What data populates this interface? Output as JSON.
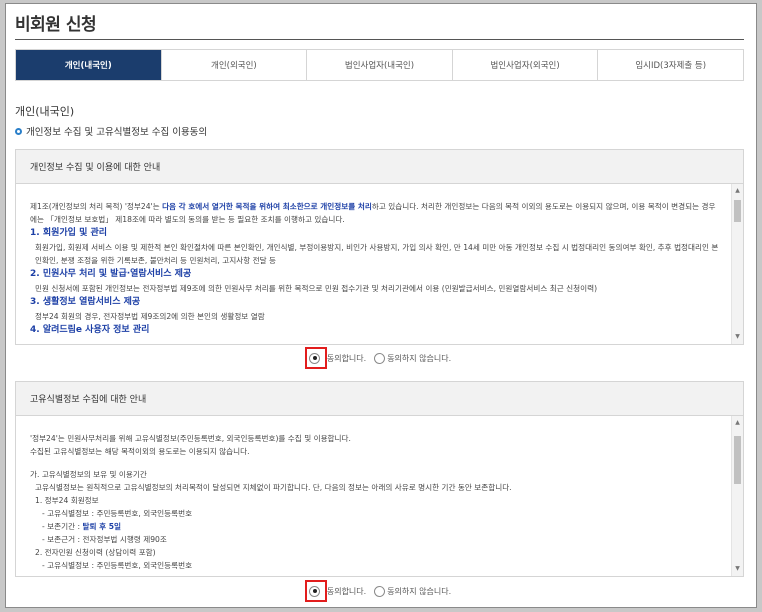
{
  "page": {
    "title": "비회원 신청"
  },
  "tabs": [
    {
      "label": "개인(내국인)",
      "active": true
    },
    {
      "label": "개인(외국인)",
      "active": false
    },
    {
      "label": "법인사업자(내국인)",
      "active": false
    },
    {
      "label": "법인사업자(외국인)",
      "active": false
    },
    {
      "label": "임시ID(3자제출 등)",
      "active": false
    }
  ],
  "section": {
    "heading": "개인(내국인)",
    "subheading": "개인정보 수집 및 고유식별정보 수집 이용동의"
  },
  "privacy_box": {
    "title": "개인정보 수집 및 이용에 대한 안내",
    "intro_a": "제1조(개인정보의 처리 목적) '정부24'는 ",
    "intro_strong": "다음 각 호에서 열거한 목적을 위하여 최소한으로 개인정보를 처리",
    "intro_b": "하고 있습니다. 처리한 개인정보는 다음의 목적 이외의 용도로는 이용되지 않으며, 이용 목적이 변경되는 경우에는 「개인정보 보호법」 제18조에 따라 별도의 동의를 받는 등 필요한 조치를 이행하고 있습니다.",
    "item1_title": "1. 회원가입 및 관리",
    "item1_text": "회원가입, 회원제 서비스 이용 및 제한적 본인 확인절차에 따른 본인확인, 개인식별, 부정이용방지, 비인가 사용방지, 가입 의사 확인, 만 14세 미만 아동 개인정보 수집 시 법정대리인 동의여부 확인, 추후 법정대리인 본인확인, 분쟁 조정을 위한 기록보존, 불만처리 등 민원처리, 고지사항 전달 등",
    "item2_title": "2. 민원사무 처리 및 발급·열람서비스 제공",
    "item2_text": "민원 신청서에 포함된 개인정보는 전자정부법 제9조에 의한 민원사무 처리를 위한 목적으로 민원 접수기관 및 처리기관에서 이용 (민원발급서비스, 민원열람서비스 최근 신청이력)",
    "item3_title": "3. 생활정보 열람서비스 제공",
    "item3_text": "정부24 회원의 경우, 전자정부법 제9조의2에 의한 본인의 생활정보 열람",
    "item4_title": "4. 알려드림e 사용자 정보 관리"
  },
  "unique_box": {
    "title": "고유식별정보 수집에 대한 안내",
    "line1": "'정부24'는 민원사무처리를 위해 고유식별정보(주민등록번호, 외국인등록번호)를 수집 및 이용합니다.",
    "line2": "수집된 고유식별정보는 해당 목적이외의 용도로는 이용되지 않습니다.",
    "line3": "가. 고유식별정보의 보유 및 이용기간",
    "line4": "고유식별정보는 원칙적으로 고유식별정보의 처리목적이 달성되면 지체없이 파기합니다. 단, 다음의 정보는 아래의 사유로 명시한 기간 동안 보존합니다.",
    "line5": "1. 정부24 회원정보",
    "line6": "- 고유식별정보 : 주민등록번호, 외국인등록번호",
    "line7_a": "- 보존기간 : ",
    "line7_strong": "탈퇴 후 5일",
    "line8": "- 보존근거 : 전자정부법 시행령 제90조",
    "line9": "2. 전자민원 신청이력 (상담이력 포함)",
    "line10": "- 고유식별정보 : 주민등록번호, 외국인등록번호"
  },
  "consent": {
    "agree": "동의합니다.",
    "disagree": "동의하지 않습니다."
  },
  "colors": {
    "active_tab": "#1b3d6d",
    "highlight": "#e21d1d",
    "emphasis": "#1c3fa6"
  }
}
